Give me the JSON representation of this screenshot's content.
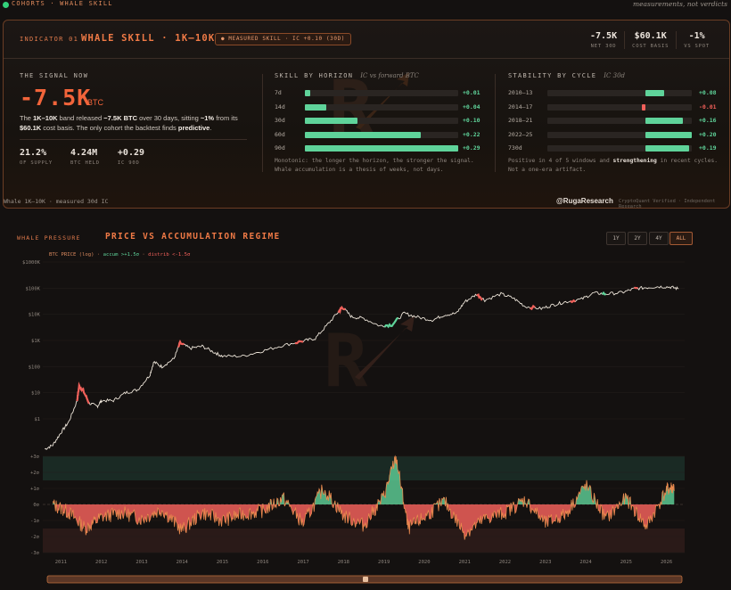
{
  "topbar": {
    "breadcrumb": "COHORTS · WHALE SKILL",
    "tagline": "measurements, not verdicts"
  },
  "indicator": {
    "label": "INDICATOR 01",
    "title": "WHALE SKILL · 1K–10K BTC",
    "badge": "● MEASURED SKILL · IC +0.10 (30D)",
    "kpis": [
      {
        "value": "-7.5K",
        "label": "NET 30D"
      },
      {
        "value": "$60.1K",
        "label": "COST BASIS"
      },
      {
        "value": "-1%",
        "label": "VS SPOT"
      }
    ]
  },
  "signal": {
    "title": "THE SIGNAL NOW",
    "value": "-7.5K",
    "unit": "BTC",
    "desc_html_parts": {
      "p1": "The ",
      "b1": "1K–10K",
      "p2": " band released ",
      "b2": "−7.5K BTC",
      "p3": " over 30 days, sitting ",
      "b3": "~1%",
      "p4": " from its ",
      "b4": "$60.1K",
      "p5": " cost basis. The only cohort the backtest finds ",
      "b5": "predictive",
      "p6": "."
    },
    "stats": [
      {
        "value": "21.2%",
        "label": "OF SUPPLY"
      },
      {
        "value": "4.24M",
        "label": "BTC HELD"
      },
      {
        "value": "+0.29",
        "label": "IC 90D"
      }
    ]
  },
  "skill_by_horizon": {
    "title": "SKILL BY HORIZON",
    "subtitle": "IC vs forward BTC",
    "rows": [
      {
        "label": "7d",
        "value": "+0.01",
        "ic": 0.01
      },
      {
        "label": "14d",
        "value": "+0.04",
        "ic": 0.04
      },
      {
        "label": "30d",
        "value": "+0.10",
        "ic": 0.1
      },
      {
        "label": "60d",
        "value": "+0.22",
        "ic": 0.22
      },
      {
        "label": "90d",
        "value": "+0.29",
        "ic": 0.29
      }
    ],
    "note": "Monotonic: the longer the horizon, the stronger the signal. Whale accumulation is a thesis of weeks, not days."
  },
  "stability_by_cycle": {
    "title": "STABILITY BY CYCLE",
    "subtitle": "IC 30d",
    "rows": [
      {
        "label": "2010–13",
        "value": "+0.08",
        "ic": 0.08
      },
      {
        "label": "2014–17",
        "value": "-0.01",
        "ic": -0.01
      },
      {
        "label": "2018–21",
        "value": "+0.16",
        "ic": 0.16
      },
      {
        "label": "2022–25",
        "value": "+0.20",
        "ic": 0.2
      },
      {
        "label": "730d",
        "value": "+0.19",
        "ic": 0.19
      }
    ],
    "note_p1": "Positive in 4 of 5 windows and ",
    "note_b": "strengthening",
    "note_p2": " in recent cycles. Not a one-era artifact."
  },
  "footer": {
    "left": "Whale 1K–10K · measured 30d IC",
    "brand": "@RugaResearch",
    "right": "CryptoQuant Verified · Independent Research"
  },
  "pressure": {
    "label": "WHALE PRESSURE",
    "title": "PRICE VS ACCUMULATION REGIME",
    "ranges": [
      {
        "label": "1Y",
        "active": false
      },
      {
        "label": "2Y",
        "active": false
      },
      {
        "label": "4Y",
        "active": false
      },
      {
        "label": "ALL",
        "active": true
      }
    ],
    "legend": {
      "price": "BTC PRICE (log)",
      "accum": "accum >+1.5σ",
      "distrib": "distrib <-1.5σ"
    }
  },
  "colors": {
    "accent": "#f07a46",
    "positive": "#5fd39a",
    "negative": "#f0605a",
    "price": "#ece4d8",
    "osc_line": "#e8894e"
  },
  "chart_data": {
    "type": "line",
    "title": "PRICE VS ACCUMULATION REGIME",
    "price_axis": {
      "scale": "log",
      "ticks": [
        "$1000K",
        "$100K",
        "$10K",
        "$1K",
        "$100",
        "$10",
        "$1"
      ]
    },
    "sigma_axis": {
      "ticks": [
        "+3σ",
        "+2σ",
        "+1σ",
        "0σ",
        "-1σ",
        "-2σ",
        "-3σ"
      ],
      "ylim": [
        -3,
        3
      ]
    },
    "x_ticks": [
      "2011",
      "2012",
      "2013",
      "2014",
      "2015",
      "2016",
      "2017",
      "2018",
      "2019",
      "2020",
      "2021",
      "2022",
      "2023",
      "2024",
      "2025",
      "2026"
    ],
    "series": [
      {
        "name": "BTC PRICE (log)",
        "x": [
          2010.6,
          2010.8,
          2011.0,
          2011.2,
          2011.4,
          2011.45,
          2011.55,
          2011.7,
          2011.9,
          2012.0,
          2012.3,
          2012.6,
          2012.9,
          2013.2,
          2013.3,
          2013.5,
          2013.8,
          2013.95,
          2014.2,
          2014.5,
          2014.8,
          2015.0,
          2015.5,
          2016.0,
          2016.5,
          2017.0,
          2017.3,
          2017.6,
          2017.9,
          2017.97,
          2018.2,
          2018.5,
          2018.9,
          2019.2,
          2019.5,
          2019.8,
          2020.2,
          2020.5,
          2020.8,
          2021.0,
          2021.3,
          2021.5,
          2021.9,
          2022.2,
          2022.5,
          2022.9,
          2023.2,
          2023.5,
          2023.9,
          2024.2,
          2024.5,
          2024.9,
          2025.2,
          2025.5,
          2025.8,
          2026.1,
          2026.3
        ],
        "y": [
          0.07,
          0.1,
          0.3,
          0.8,
          5,
          18,
          12,
          4,
          3,
          5,
          5,
          10,
          13,
          47,
          150,
          100,
          200,
          800,
          500,
          600,
          350,
          250,
          250,
          400,
          650,
          950,
          1200,
          4000,
          14000,
          19000,
          8000,
          7000,
          3600,
          4000,
          11000,
          8000,
          6000,
          9500,
          11000,
          30000,
          58000,
          35000,
          60000,
          42000,
          20000,
          16500,
          23000,
          30000,
          38000,
          66000,
          60000,
          68000,
          95000,
          105000,
          115000,
          110000,
          95000
        ]
      }
    ],
    "accumulation_regime_sigma_sample": {
      "x": [
        2010.8,
        2011.2,
        2011.6,
        2012.0,
        2012.5,
        2013.0,
        2013.5,
        2014.0,
        2014.5,
        2015.0,
        2015.5,
        2016.0,
        2016.5,
        2017.0,
        2017.5,
        2018.0,
        2018.5,
        2019.0,
        2019.3,
        2019.6,
        2020.0,
        2020.5,
        2021.0,
        2021.5,
        2022.0,
        2022.5,
        2023.0,
        2023.5,
        2024.0,
        2024.5,
        2025.0,
        2025.5,
        2026.0,
        2026.2
      ],
      "y": [
        0.0,
        -0.5,
        -1.5,
        -0.8,
        -0.5,
        -0.9,
        -0.3,
        -1.6,
        -0.5,
        -1.0,
        -0.6,
        -0.4,
        0.4,
        -1.2,
        1.0,
        -0.7,
        -1.3,
        0.5,
        3.0,
        -1.5,
        -0.8,
        0.2,
        -1.8,
        -0.9,
        -0.5,
        0.3,
        -1.2,
        -0.6,
        1.2,
        -0.9,
        0.4,
        -1.4,
        0.9,
        1.1
      ]
    }
  }
}
